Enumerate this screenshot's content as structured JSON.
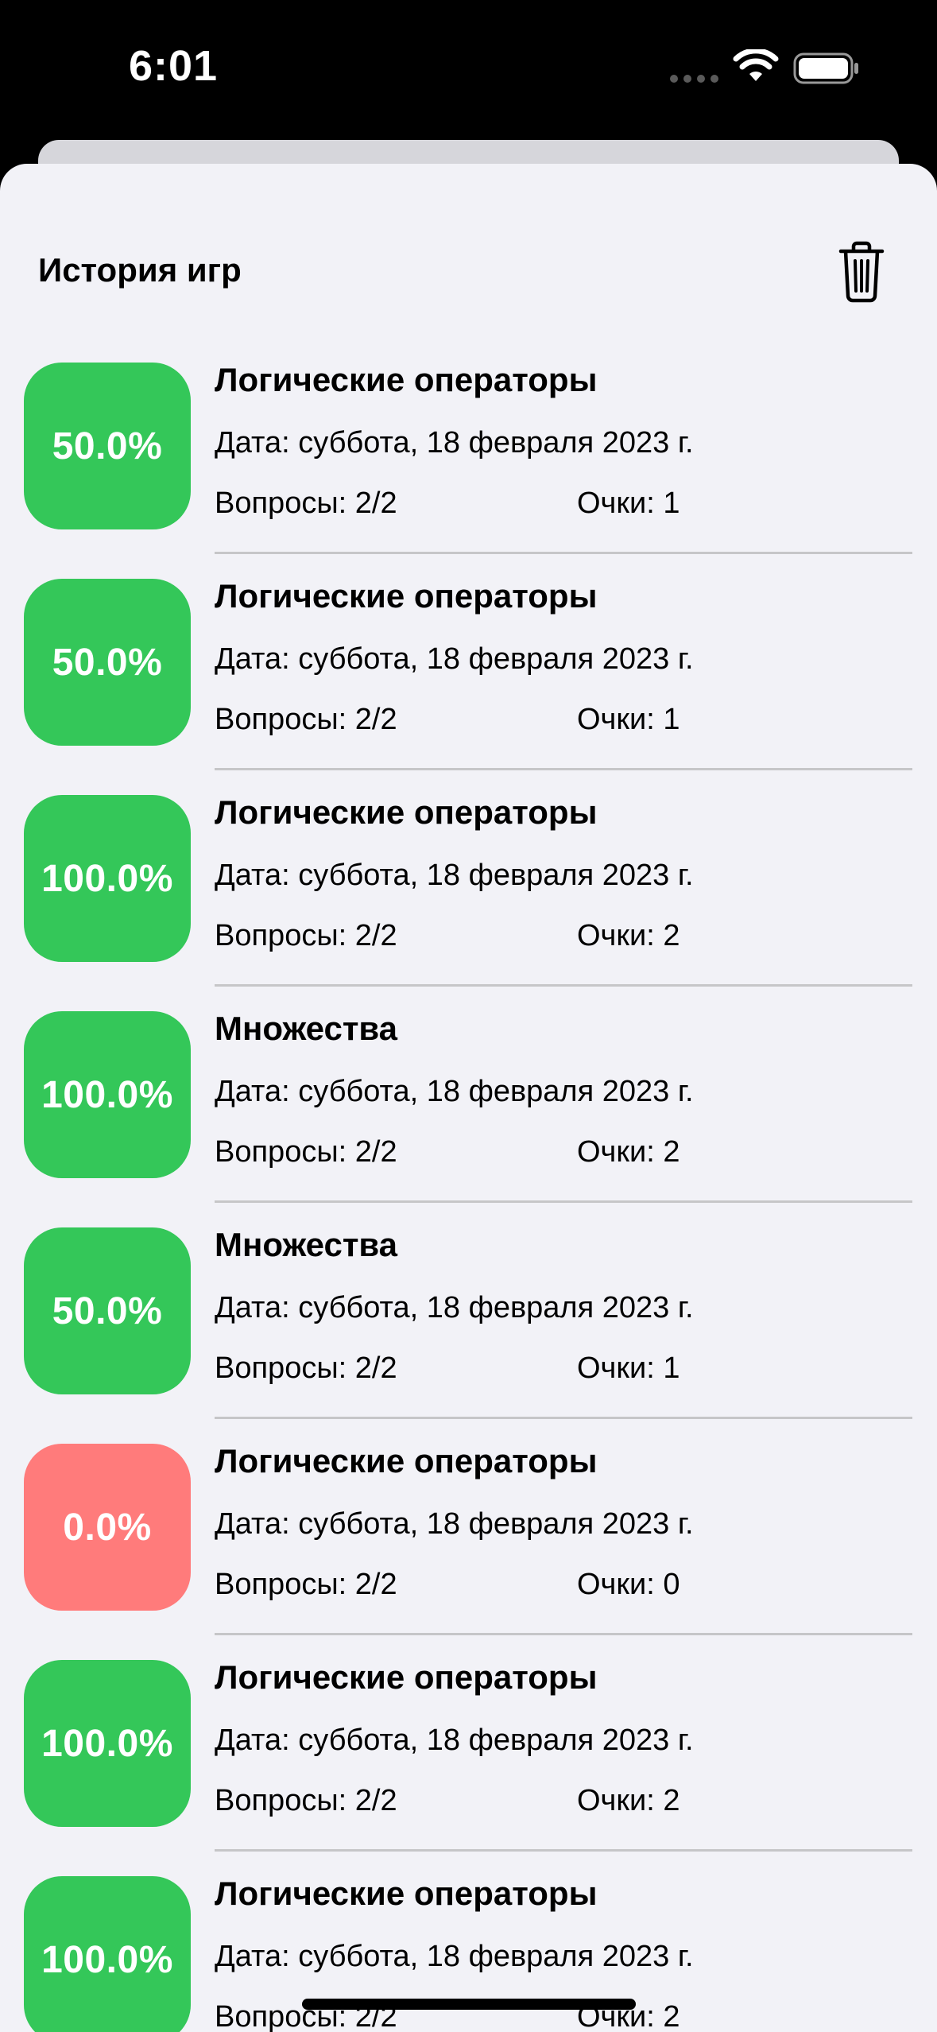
{
  "status_bar": {
    "time": "6:01"
  },
  "header": {
    "title": "История игр",
    "trash_icon": "trash-icon"
  },
  "colors": {
    "success": "#34c759",
    "fail": "#ff7b7b",
    "background": "#f2f2f7"
  },
  "games": [
    {
      "percent": "50.0%",
      "percent_value": 50.0,
      "title": "Логические операторы",
      "date": "Дата: суббота, 18 февраля 2023 г.",
      "questions": "Вопросы: 2/2",
      "score": "Очки: 1"
    },
    {
      "percent": "50.0%",
      "percent_value": 50.0,
      "title": "Логические операторы",
      "date": "Дата: суббота, 18 февраля 2023 г.",
      "questions": "Вопросы: 2/2",
      "score": "Очки: 1"
    },
    {
      "percent": "100.0%",
      "percent_value": 100.0,
      "title": "Логические операторы",
      "date": "Дата: суббота, 18 февраля 2023 г.",
      "questions": "Вопросы: 2/2",
      "score": "Очки: 2"
    },
    {
      "percent": "100.0%",
      "percent_value": 100.0,
      "title": "Множества",
      "date": "Дата: суббота, 18 февраля 2023 г.",
      "questions": "Вопросы: 2/2",
      "score": "Очки: 2"
    },
    {
      "percent": "50.0%",
      "percent_value": 50.0,
      "title": "Множества",
      "date": "Дата: суббота, 18 февраля 2023 г.",
      "questions": "Вопросы: 2/2",
      "score": "Очки: 1"
    },
    {
      "percent": "0.0%",
      "percent_value": 0.0,
      "title": "Логические операторы",
      "date": "Дата: суббота, 18 февраля 2023 г.",
      "questions": "Вопросы: 2/2",
      "score": "Очки: 0"
    },
    {
      "percent": "100.0%",
      "percent_value": 100.0,
      "title": "Логические операторы",
      "date": "Дата: суббота, 18 февраля 2023 г.",
      "questions": "Вопросы: 2/2",
      "score": "Очки: 2"
    },
    {
      "percent": "100.0%",
      "percent_value": 100.0,
      "title": "Логические операторы",
      "date": "Дата: суббота, 18 февраля 2023 г.",
      "questions": "Вопросы: 2/2",
      "score": "Очки: 2"
    }
  ]
}
